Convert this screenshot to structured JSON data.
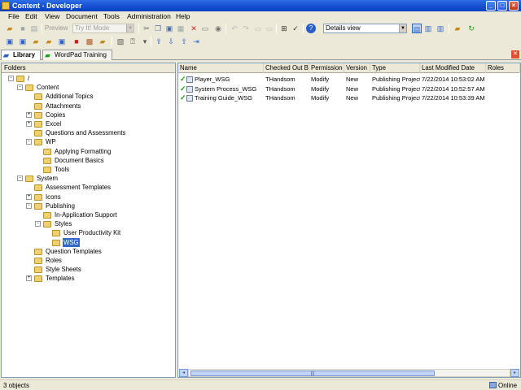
{
  "window": {
    "title": "Content - Developer"
  },
  "menu": [
    "File",
    "Edit",
    "View",
    "Document",
    "Tools",
    "Administration",
    "Help"
  ],
  "toolbar": {
    "preview_label": "Preview",
    "mode_combo": "Try It! Mode",
    "view_combo": "Details view"
  },
  "tabs": [
    {
      "label": "Library"
    },
    {
      "label": "WordPad Training"
    }
  ],
  "folders": {
    "header": "Folders",
    "nodes": [
      {
        "label": "/",
        "expander": "-"
      },
      {
        "label": "Content",
        "expander": "-"
      },
      {
        "label": "Additional Topics",
        "expander": ""
      },
      {
        "label": "Attachments",
        "expander": ""
      },
      {
        "label": "Copies",
        "expander": "+"
      },
      {
        "label": "Excel",
        "expander": "+"
      },
      {
        "label": "Questions and Assessments",
        "expander": ""
      },
      {
        "label": "WP",
        "expander": "-"
      },
      {
        "label": "Applying Formatting",
        "expander": ""
      },
      {
        "label": "Document Basics",
        "expander": ""
      },
      {
        "label": "Tools",
        "expander": ""
      },
      {
        "label": "System",
        "expander": "-"
      },
      {
        "label": "Assessment Templates",
        "expander": ""
      },
      {
        "label": "Icons",
        "expander": "+"
      },
      {
        "label": "Publishing",
        "expander": "-"
      },
      {
        "label": "In-Application Support",
        "expander": ""
      },
      {
        "label": "Styles",
        "expander": "-"
      },
      {
        "label": "User Productivity Kit",
        "expander": ""
      },
      {
        "label": "WSG",
        "expander": ""
      },
      {
        "label": "Question Templates",
        "expander": ""
      },
      {
        "label": "Roles",
        "expander": ""
      },
      {
        "label": "Style Sheets",
        "expander": ""
      },
      {
        "label": "Templates",
        "expander": "+"
      }
    ]
  },
  "grid": {
    "columns": [
      "Name",
      "Checked Out By",
      "Permission",
      "Version",
      "Type",
      "Last Modified Date",
      "Roles"
    ],
    "rows": [
      [
        "Player_WSG",
        "THandsom",
        "Modify",
        "New",
        "Publishing Project",
        "7/22/2014 10:53:02 AM",
        ""
      ],
      [
        "System Process_WSG",
        "THandsom",
        "Modify",
        "New",
        "Publishing Project",
        "7/22/2014 10:52:57 AM",
        ""
      ],
      [
        "Training Guide_WSG",
        "THandsom",
        "Modify",
        "New",
        "Publishing Project",
        "7/22/2014 10:53:39 AM",
        ""
      ]
    ]
  },
  "status": {
    "count": "3 objects",
    "connection": "Online"
  },
  "colors": {
    "title_bar": "#0a3fbf",
    "selection": "#316ac5",
    "check": "#1c9c1c"
  }
}
